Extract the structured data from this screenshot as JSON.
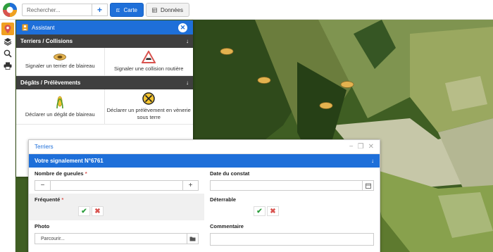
{
  "colors": {
    "accent": "#1e6fd9",
    "section_bg": "#3f3f3f",
    "required": "#d9534f",
    "yes": "#2e9e3e",
    "no": "#d9534f"
  },
  "search": {
    "placeholder": "Rechercher...",
    "add_label": "+"
  },
  "toolbar": {
    "carte_label": "Carte",
    "donnees_label": "Données",
    "carte_icon": "map-icon",
    "donnees_icon": "table-icon"
  },
  "left_tools": [
    {
      "name": "location-marker-icon"
    },
    {
      "name": "layers-icon"
    },
    {
      "name": "search-icon"
    },
    {
      "name": "print-icon"
    }
  ],
  "assistant": {
    "title": "Assistant",
    "sections": [
      {
        "title": "Terriers / Collisions",
        "chevron": "↓",
        "items": [
          {
            "label": "Signaler un terrier de blaireau",
            "icon": "burrow-icon"
          },
          {
            "label": "Signaler une collision routière",
            "icon": "road-collision-sign-icon"
          }
        ]
      },
      {
        "title": "Dégâts / Prélèvements",
        "chevron": "↓",
        "items": [
          {
            "label": "Déclarer un dégât de blaireau",
            "icon": "corn-icon"
          },
          {
            "label": "Déclarer un prélèvement en vènerie sous terre",
            "icon": "no-entry-icon"
          }
        ]
      }
    ]
  },
  "form": {
    "window_title": "Terriers",
    "header": "Votre signalement N°6761",
    "chevron": "↓",
    "fields": {
      "gueules_label": "Nombre de gueules",
      "required_mark": "*",
      "date_label": "Date du constat",
      "frequente_label": "Fréquenté",
      "deterrable_label": "Déterrable",
      "photo_label": "Photo",
      "photo_button": "Parcourir...",
      "commentaire_label": "Commentaire",
      "minus": "−",
      "plus": "+",
      "yes_symbol": "✔",
      "no_symbol": "✖"
    }
  }
}
